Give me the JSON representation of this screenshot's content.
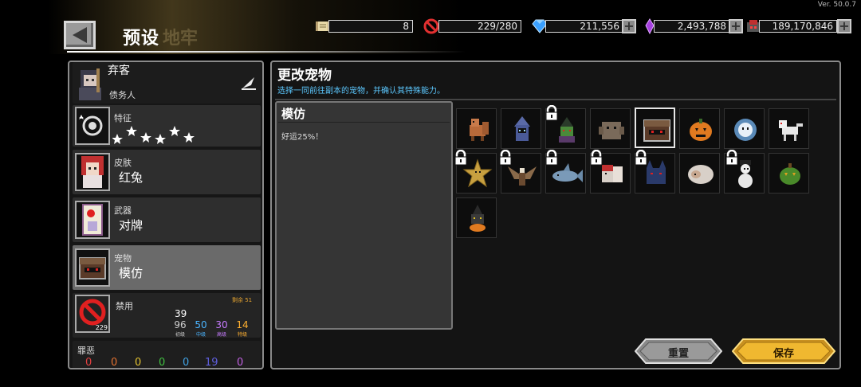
{
  "header": {
    "title": "预设",
    "subtitle": "地牢",
    "version": "Ver. 50.0.7"
  },
  "resources": [
    {
      "icon": "scroll-icon",
      "value": "8"
    },
    {
      "icon": "ban-icon",
      "value": "229/280"
    },
    {
      "icon": "gem-icon",
      "value": "211,556"
    },
    {
      "icon": "crystal-icon",
      "value": "2,493,788"
    },
    {
      "icon": "soul-icon",
      "value": "189,170,846"
    }
  ],
  "character": {
    "name": "弃客",
    "title": "债务人"
  },
  "traits": {
    "label": "特征"
  },
  "skin": {
    "label": "皮肤",
    "value": "红兔"
  },
  "weapon": {
    "label": "武器",
    "value": "对牌"
  },
  "pet": {
    "label": "宠物",
    "value": "模仿"
  },
  "ban": {
    "label": "禁用",
    "remaining": "剩余 51",
    "icon_count": "229",
    "total": "39",
    "tiers": [
      {
        "value": "96",
        "label": "初级",
        "color": "#cfcfcf"
      },
      {
        "value": "50",
        "label": "中级",
        "color": "#4ab4ff"
      },
      {
        "value": "30",
        "label": "高级",
        "color": "#c77bff"
      },
      {
        "value": "14",
        "label": "特级",
        "color": "#ffb030"
      }
    ]
  },
  "sin": {
    "label": "罪恶",
    "values": [
      "0",
      "0",
      "0",
      "0",
      "0",
      "19",
      "0"
    ]
  },
  "main": {
    "title": "更改宠物",
    "subtitle": "选择一同前往副本的宠物，并确认其特殊能力。",
    "detail_title": "模仿",
    "detail_desc": "好运25%！"
  },
  "pets": [
    {
      "name": "fox",
      "locked": false,
      "selected": false
    },
    {
      "name": "ghost-mage",
      "locked": false,
      "selected": false
    },
    {
      "name": "goblin-witch",
      "locked": true,
      "selected": false
    },
    {
      "name": "golem",
      "locked": false,
      "selected": false
    },
    {
      "name": "mimic",
      "locked": false,
      "selected": true
    },
    {
      "name": "pumpkin",
      "locked": false,
      "selected": false
    },
    {
      "name": "yeti",
      "locked": false,
      "selected": false
    },
    {
      "name": "white-wolf",
      "locked": false,
      "selected": false
    },
    {
      "name": "star-badge",
      "locked": true,
      "selected": false
    },
    {
      "name": "eagle",
      "locked": true,
      "selected": false
    },
    {
      "name": "shark",
      "locked": true,
      "selected": false
    },
    {
      "name": "squirrel",
      "locked": true,
      "selected": false
    },
    {
      "name": "dark-wolf",
      "locked": true,
      "selected": false
    },
    {
      "name": "sheep",
      "locked": false,
      "selected": false
    },
    {
      "name": "snowman",
      "locked": true,
      "selected": false
    },
    {
      "name": "green-pumpkin",
      "locked": false,
      "selected": false
    },
    {
      "name": "witch-cat",
      "locked": false,
      "selected": false
    }
  ],
  "buttons": {
    "reset": "重置",
    "save": "保存"
  }
}
